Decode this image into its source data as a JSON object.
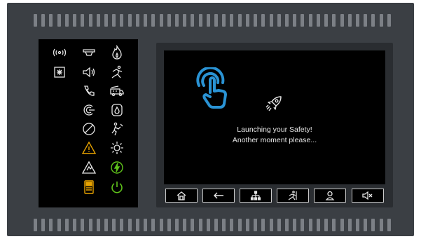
{
  "display": {
    "message_line1": "Launching your Safety!",
    "message_line2": "Another moment please..."
  },
  "colors": {
    "accent_blue": "#2a93d4",
    "warning_orange": "#e8a300",
    "power_green": "#5fc31b",
    "icon_white": "#e6e6e6"
  },
  "led_indicators": [
    "alarm-broadcast-icon",
    "smoke-detector-icon",
    "fire-icon",
    "special-detector-icon",
    "sounder-icon",
    "evacuation-icon",
    "phone-icon",
    "fire-truck-icon",
    "detector-disabled-icon",
    "extinguishing-icon",
    "disabled-icon",
    "test-icon",
    "fault-warning-icon",
    "day-mode-icon",
    "zone-warning-icon",
    "power-lightning-icon",
    "battery-icon",
    "power-on-icon"
  ],
  "nav_buttons": [
    "home-icon",
    "back-arrow-icon",
    "network-icon",
    "evacuation-icon",
    "user-icon",
    "mute-icon"
  ]
}
